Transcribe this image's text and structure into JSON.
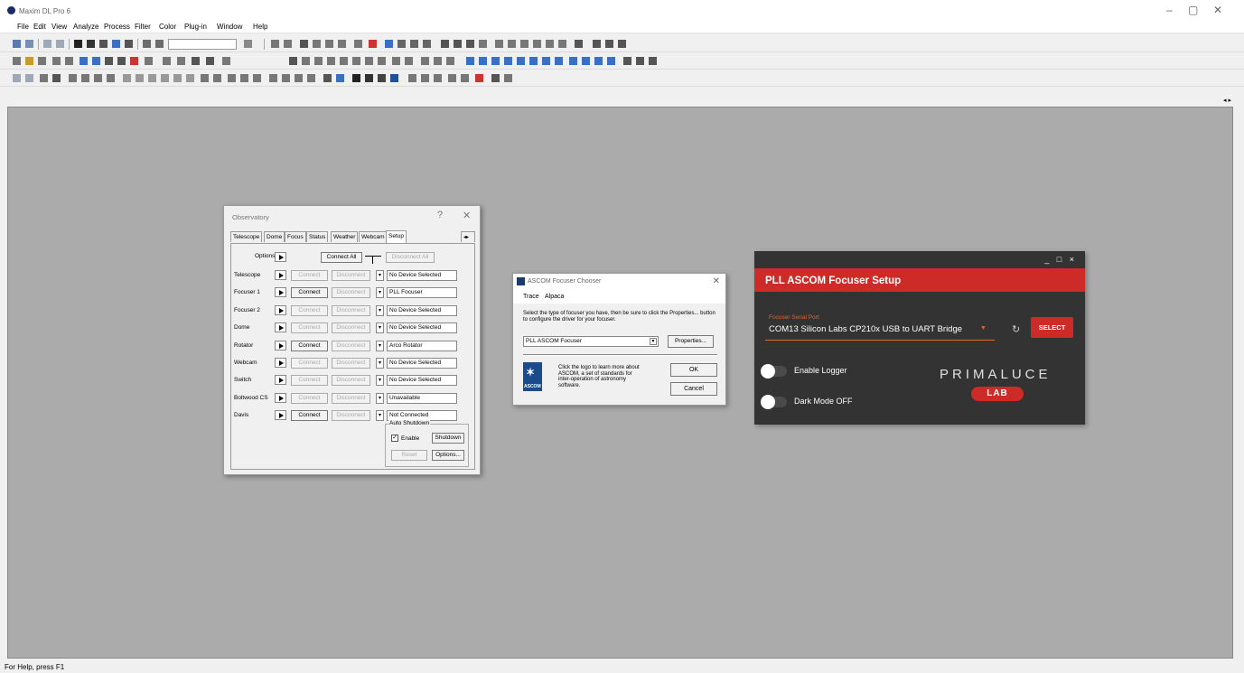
{
  "app": {
    "title": "Maxim DL Pro 6",
    "status": "For Help, press F1"
  },
  "menu": [
    "File",
    "Edit",
    "View",
    "Analyze",
    "Process",
    "Filter",
    "Color",
    "Plug-in",
    "Window",
    "Help"
  ],
  "observatory": {
    "title": "Observatory",
    "tabs": [
      "Telescope",
      "Dome",
      "Focus",
      "Status",
      "Weather",
      "Webcam",
      "Setup"
    ],
    "active_tab": "Setup",
    "options_label": "Options",
    "connect_all": "Connect All",
    "disconnect_all": "Disconnect All",
    "connect": "Connect",
    "disconnect": "Disconnect",
    "devices": [
      {
        "name": "Telescope",
        "connect_enabled": false,
        "value": "No Device Selected"
      },
      {
        "name": "Focuser 1",
        "connect_enabled": true,
        "value": "PLL Focuser"
      },
      {
        "name": "Focuser 2",
        "connect_enabled": false,
        "value": "No Device Selected"
      },
      {
        "name": "Dome",
        "connect_enabled": false,
        "value": "No Device Selected"
      },
      {
        "name": "Rotator",
        "connect_enabled": true,
        "value": "Arco Rotator"
      },
      {
        "name": "Webcam",
        "connect_enabled": false,
        "value": "No Device Selected"
      },
      {
        "name": "Switch",
        "connect_enabled": false,
        "value": "No Device Selected"
      },
      {
        "name": "Boltwood CS",
        "connect_enabled": false,
        "value": "Unavailable"
      },
      {
        "name": "Davis",
        "connect_enabled": true,
        "value": "Not Connected"
      }
    ],
    "auto_shutdown": {
      "title": "Auto Shutdown",
      "enable": "Enable",
      "enabled": true,
      "shutdown": "Shutdown",
      "reset": "Reset",
      "options": "Options..."
    }
  },
  "chooser": {
    "title": "ASCOM Focuser Chooser",
    "menu": [
      "Trace",
      "Alpaca"
    ],
    "instructions": "Select the type of focuser you have, then be sure to click the Properties... button to configure the driver for your focuser.",
    "selected": "PLL ASCOM Focuser",
    "properties": "Properties...",
    "logo_text": "ASCOM",
    "info": "Click the logo to learn more about ASCOM, a set of standards for inter-operation of astronomy software.",
    "ok": "OK",
    "cancel": "Cancel"
  },
  "pll": {
    "title": "PLL ASCOM Focuser Setup",
    "port_label": "Focuser Serial Port",
    "port_value": "COM13  Silicon Labs CP210x USB to UART Bridge",
    "select": "SELECT",
    "enable_logger": "Enable Logger",
    "enable_logger_on": false,
    "dark_mode": "Dark Mode OFF",
    "dark_mode_on": false,
    "brand": "PRIMALUCE",
    "brand_sub": "LAB"
  },
  "colors": {
    "accent": "#cc2b27",
    "orange": "#e8651e",
    "workspace": "#ababab"
  }
}
